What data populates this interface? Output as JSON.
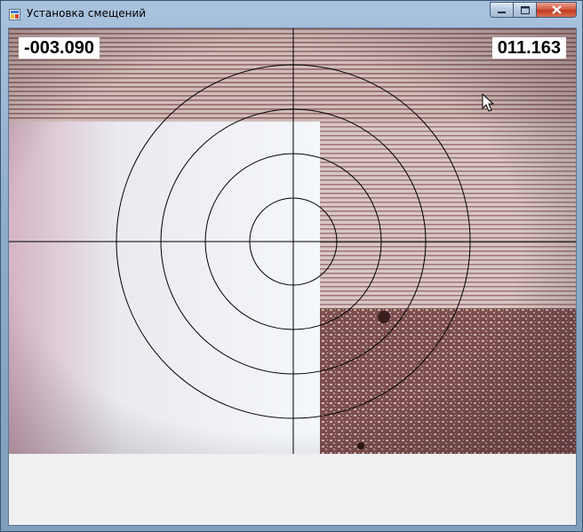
{
  "window": {
    "title": "Установка смещений"
  },
  "title_buttons": [
    "minimize",
    "maximize",
    "close"
  ],
  "icons": {
    "app": "app-icon",
    "minimize": "minimize-icon",
    "maximize": "maximize-icon",
    "close": "close-icon",
    "cursor": "mouse-pointer-icon"
  },
  "camera": {
    "x_readout": "-003.090",
    "y_readout": "011.163",
    "reticle_rings": 4
  },
  "colors": {
    "readout_background": "#ffffff",
    "reticle": "#000000",
    "close_button": "#c8442b"
  }
}
